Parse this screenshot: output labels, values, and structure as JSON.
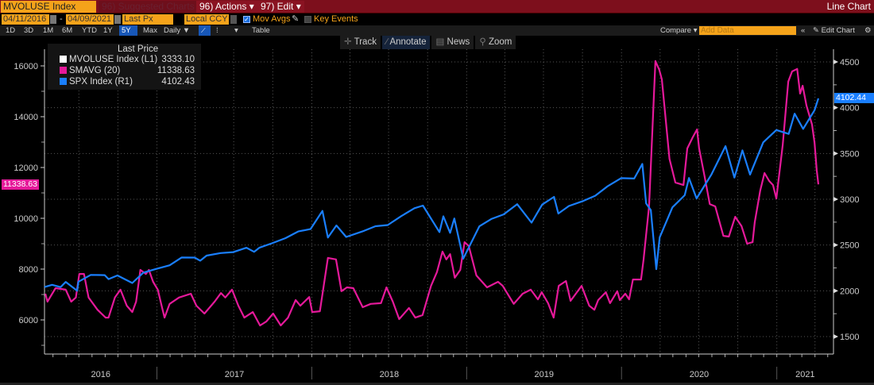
{
  "header": {
    "ticker": "MVOLUSE Index",
    "suggested": "96) Suggested Charts",
    "actions": "96) Actions ▾",
    "edit": "97) Edit ▾",
    "chart_type": "Line Chart"
  },
  "controls": {
    "start_date": "04/11/2016",
    "dash": "-",
    "end_date": "04/09/2021",
    "field": "Last Px",
    "currency": "Local CCY",
    "mov_avgs": "Mov Avgs",
    "mov_avgs_checked": true,
    "key_events": "Key Events",
    "key_events_checked": false
  },
  "periods": [
    "1D",
    "3D",
    "1M",
    "6M",
    "YTD",
    "1Y",
    "5Y",
    "Max"
  ],
  "selected_period": "5Y",
  "frequency": "Daily ▼",
  "table": "Table",
  "right_controls": {
    "compare": "Compare ▾",
    "add_data_placeholder": "Add Data",
    "collapse": "«",
    "edit_chart": "✎ Edit Chart",
    "settings_icon": "gear-icon"
  },
  "tools": [
    {
      "icon": "crosshair-icon",
      "label": "Track"
    },
    {
      "icon": "pencil-icon",
      "label": "Annotate"
    },
    {
      "icon": "news-icon",
      "label": "News"
    },
    {
      "icon": "magnifier-icon",
      "label": "Zoom"
    }
  ],
  "legend": {
    "title": "Last Price",
    "items": [
      {
        "name": "MVOLUSE Index  (L1)",
        "value": "3333.10",
        "color": "#ffffff"
      },
      {
        "name": "SMAVG (20)",
        "value": "11338.63",
        "color": "#e5199a"
      },
      {
        "name": "SPX Index  (R1)",
        "value": "4102.43",
        "color": "#1a7fff"
      }
    ]
  },
  "chart_data": {
    "type": "line",
    "x_range": [
      "2016-04-11",
      "2021-04-09"
    ],
    "year_labels": [
      "2016",
      "2017",
      "2018",
      "2019",
      "2020",
      "2021"
    ],
    "left_axis": {
      "ticks": [
        6000,
        8000,
        10000,
        12000,
        14000,
        16000
      ],
      "range": [
        5300,
        16800
      ],
      "last_label": "11338.63"
    },
    "right_axis": {
      "ticks": [
        1500,
        2000,
        2500,
        3000,
        3500,
        4000,
        4500
      ],
      "range": [
        1500,
        4630
      ],
      "last_label": "4102.44"
    },
    "grid": true,
    "series": [
      {
        "name": "SMAVG (20)",
        "axis": "left",
        "color": "#e5199a",
        "points": [
          [
            "2016-04-13",
            7030
          ],
          [
            "2016-04-18",
            6720
          ],
          [
            "2016-05-07",
            7250
          ],
          [
            "2016-05-31",
            7190
          ],
          [
            "2016-06-13",
            6720
          ],
          [
            "2016-06-24",
            6880
          ],
          [
            "2016-07-02",
            7810
          ],
          [
            "2016-07-13",
            7810
          ],
          [
            "2016-07-24",
            6880
          ],
          [
            "2016-08-14",
            6400
          ],
          [
            "2016-09-02",
            6090
          ],
          [
            "2016-09-09",
            6090
          ],
          [
            "2016-09-24",
            6880
          ],
          [
            "2016-10-07",
            7190
          ],
          [
            "2016-10-22",
            6560
          ],
          [
            "2016-11-04",
            6310
          ],
          [
            "2016-11-13",
            6720
          ],
          [
            "2016-11-23",
            7970
          ],
          [
            "2016-12-06",
            7810
          ],
          [
            "2016-12-13",
            7970
          ],
          [
            "2016-12-23",
            7500
          ],
          [
            "2017-01-03",
            7190
          ],
          [
            "2017-01-12",
            6560
          ],
          [
            "2017-01-19",
            6090
          ],
          [
            "2017-01-31",
            6630
          ],
          [
            "2017-02-22",
            6880
          ],
          [
            "2017-03-22",
            7030
          ],
          [
            "2017-04-04",
            6560
          ],
          [
            "2017-04-23",
            6250
          ],
          [
            "2017-05-17",
            6720
          ],
          [
            "2017-06-01",
            7060
          ],
          [
            "2017-06-11",
            6880
          ],
          [
            "2017-06-27",
            7190
          ],
          [
            "2017-07-12",
            6560
          ],
          [
            "2017-07-26",
            6090
          ],
          [
            "2017-08-15",
            6310
          ],
          [
            "2017-09-01",
            5780
          ],
          [
            "2017-09-16",
            5940
          ],
          [
            "2017-10-02",
            6250
          ],
          [
            "2017-10-20",
            5780
          ],
          [
            "2017-11-06",
            6090
          ],
          [
            "2017-11-24",
            6780
          ],
          [
            "2017-12-05",
            6560
          ],
          [
            "2017-12-26",
            6900
          ],
          [
            "2018-01-02",
            6310
          ],
          [
            "2018-01-20",
            6340
          ],
          [
            "2018-02-08",
            8440
          ],
          [
            "2018-02-27",
            8380
          ],
          [
            "2018-03-12",
            7130
          ],
          [
            "2018-03-25",
            7280
          ],
          [
            "2018-04-09",
            7250
          ],
          [
            "2018-05-01",
            6500
          ],
          [
            "2018-05-20",
            6630
          ],
          [
            "2018-06-13",
            6660
          ],
          [
            "2018-06-26",
            7280
          ],
          [
            "2018-07-11",
            6720
          ],
          [
            "2018-07-26",
            6030
          ],
          [
            "2018-08-18",
            6470
          ],
          [
            "2018-09-02",
            6090
          ],
          [
            "2018-09-19",
            6190
          ],
          [
            "2018-10-09",
            7340
          ],
          [
            "2018-10-23",
            7880
          ],
          [
            "2018-11-05",
            8690
          ],
          [
            "2018-11-14",
            8380
          ],
          [
            "2018-11-23",
            8590
          ],
          [
            "2018-12-04",
            7660
          ],
          [
            "2018-12-17",
            7970
          ],
          [
            "2018-12-27",
            9060
          ],
          [
            "2019-01-06",
            8910
          ],
          [
            "2019-01-24",
            7750
          ],
          [
            "2019-02-18",
            7280
          ],
          [
            "2019-03-16",
            7500
          ],
          [
            "2019-03-27",
            7340
          ],
          [
            "2019-04-22",
            6630
          ],
          [
            "2019-05-13",
            7030
          ],
          [
            "2019-06-01",
            7190
          ],
          [
            "2019-06-18",
            6810
          ],
          [
            "2019-06-27",
            7090
          ],
          [
            "2019-07-12",
            6660
          ],
          [
            "2019-07-25",
            6090
          ],
          [
            "2019-08-06",
            7340
          ],
          [
            "2019-08-23",
            7530
          ],
          [
            "2019-09-03",
            6750
          ],
          [
            "2019-09-29",
            7340
          ],
          [
            "2019-10-17",
            6560
          ],
          [
            "2019-10-29",
            6400
          ],
          [
            "2019-11-07",
            6780
          ],
          [
            "2019-11-25",
            7090
          ],
          [
            "2019-12-05",
            6660
          ],
          [
            "2019-12-22",
            7130
          ],
          [
            "2019-12-28",
            6780
          ],
          [
            "2020-01-10",
            7030
          ],
          [
            "2020-01-19",
            6810
          ],
          [
            "2020-01-28",
            7590
          ],
          [
            "2020-02-16",
            7590
          ],
          [
            "2020-02-22",
            8380
          ],
          [
            "2020-03-06",
            10470
          ],
          [
            "2020-03-21",
            16190
          ],
          [
            "2020-03-30",
            15840
          ],
          [
            "2020-04-05",
            15470
          ],
          [
            "2020-04-23",
            12340
          ],
          [
            "2020-05-07",
            11410
          ],
          [
            "2020-05-26",
            11310
          ],
          [
            "2020-06-04",
            12750
          ],
          [
            "2020-06-17",
            13190
          ],
          [
            "2020-06-27",
            13500
          ],
          [
            "2020-07-02",
            12750
          ],
          [
            "2020-07-15",
            11630
          ],
          [
            "2020-07-27",
            10560
          ],
          [
            "2020-08-09",
            10470
          ],
          [
            "2020-08-28",
            9310
          ],
          [
            "2020-09-10",
            9280
          ],
          [
            "2020-09-25",
            10060
          ],
          [
            "2020-10-10",
            9690
          ],
          [
            "2020-10-23",
            9000
          ],
          [
            "2020-11-05",
            9060
          ],
          [
            "2020-11-10",
            9840
          ],
          [
            "2020-11-23",
            11090
          ],
          [
            "2020-12-03",
            11780
          ],
          [
            "2020-12-14",
            11470
          ],
          [
            "2020-12-23",
            11310
          ],
          [
            "2020-12-31",
            10780
          ],
          [
            "2021-01-15",
            12880
          ],
          [
            "2021-01-28",
            15380
          ],
          [
            "2021-02-06",
            15780
          ],
          [
            "2021-02-18",
            15880
          ],
          [
            "2021-02-25",
            14910
          ],
          [
            "2021-03-03",
            15220
          ],
          [
            "2021-03-12",
            14440
          ],
          [
            "2021-03-25",
            13690
          ],
          [
            "2021-03-31",
            12970
          ],
          [
            "2021-04-05",
            11900
          ],
          [
            "2021-04-09",
            11338.63
          ]
        ]
      },
      {
        "name": "SPX Index  (R1)",
        "axis": "right",
        "color": "#1a7fff",
        "points": [
          [
            "2016-04-11",
            2041
          ],
          [
            "2016-04-29",
            2065
          ],
          [
            "2016-05-19",
            2040
          ],
          [
            "2016-05-31",
            2097
          ],
          [
            "2016-06-27",
            2000
          ],
          [
            "2016-06-30",
            2099
          ],
          [
            "2016-07-29",
            2174
          ],
          [
            "2016-08-31",
            2171
          ],
          [
            "2016-09-09",
            2128
          ],
          [
            "2016-09-30",
            2168
          ],
          [
            "2016-11-04",
            2085
          ],
          [
            "2016-11-30",
            2199
          ],
          [
            "2016-12-30",
            2239
          ],
          [
            "2017-01-31",
            2279
          ],
          [
            "2017-02-28",
            2364
          ],
          [
            "2017-03-31",
            2363
          ],
          [
            "2017-04-13",
            2329
          ],
          [
            "2017-04-28",
            2384
          ],
          [
            "2017-05-31",
            2412
          ],
          [
            "2017-06-30",
            2423
          ],
          [
            "2017-07-31",
            2470
          ],
          [
            "2017-08-18",
            2426
          ],
          [
            "2017-08-31",
            2472
          ],
          [
            "2017-09-29",
            2519
          ],
          [
            "2017-10-31",
            2575
          ],
          [
            "2017-11-30",
            2648
          ],
          [
            "2017-12-29",
            2674
          ],
          [
            "2018-01-26",
            2873
          ],
          [
            "2018-02-08",
            2581
          ],
          [
            "2018-02-28",
            2714
          ],
          [
            "2018-03-23",
            2588
          ],
          [
            "2018-04-30",
            2648
          ],
          [
            "2018-05-31",
            2705
          ],
          [
            "2018-06-29",
            2718
          ],
          [
            "2018-07-31",
            2816
          ],
          [
            "2018-08-31",
            2902
          ],
          [
            "2018-09-20",
            2931
          ],
          [
            "2018-10-29",
            2641
          ],
          [
            "2018-11-07",
            2814
          ],
          [
            "2018-11-23",
            2633
          ],
          [
            "2018-12-03",
            2790
          ],
          [
            "2018-12-24",
            2351
          ],
          [
            "2019-01-31",
            2704
          ],
          [
            "2019-02-28",
            2784
          ],
          [
            "2019-03-29",
            2834
          ],
          [
            "2019-04-30",
            2946
          ],
          [
            "2019-06-03",
            2744
          ],
          [
            "2019-06-28",
            2942
          ],
          [
            "2019-07-26",
            3026
          ],
          [
            "2019-08-05",
            2844
          ],
          [
            "2019-08-30",
            2926
          ],
          [
            "2019-09-30",
            2977
          ],
          [
            "2019-10-31",
            3038
          ],
          [
            "2019-11-29",
            3141
          ],
          [
            "2019-12-31",
            3231
          ],
          [
            "2020-01-31",
            3226
          ],
          [
            "2020-02-19",
            3386
          ],
          [
            "2020-02-28",
            2954
          ],
          [
            "2020-03-10",
            2882
          ],
          [
            "2020-03-23",
            2237
          ],
          [
            "2020-03-31",
            2585
          ],
          [
            "2020-04-30",
            2912
          ],
          [
            "2020-05-29",
            3044
          ],
          [
            "2020-06-08",
            3232
          ],
          [
            "2020-06-26",
            3009
          ],
          [
            "2020-07-31",
            3271
          ],
          [
            "2020-09-02",
            3580
          ],
          [
            "2020-09-23",
            3237
          ],
          [
            "2020-10-12",
            3534
          ],
          [
            "2020-10-30",
            3270
          ],
          [
            "2020-11-30",
            3622
          ],
          [
            "2020-12-31",
            3756
          ],
          [
            "2021-01-29",
            3714
          ],
          [
            "2021-02-12",
            3935
          ],
          [
            "2021-03-04",
            3768
          ],
          [
            "2021-03-31",
            3973
          ],
          [
            "2021-04-09",
            4102.44
          ]
        ]
      }
    ]
  }
}
